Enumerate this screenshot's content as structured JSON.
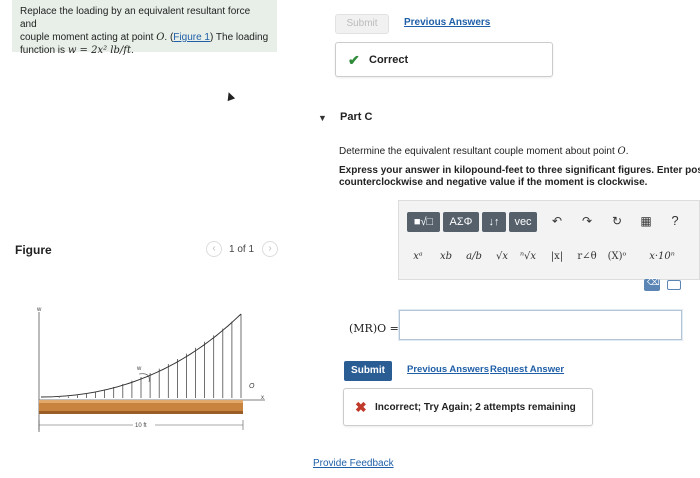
{
  "problem": {
    "line1": "Replace the loading by an equivalent resultant force and",
    "line2_pre": "couple moment acting at point ",
    "point": "O",
    "line2_mid": ". (",
    "figure_link": "Figure 1",
    "line2_post": ") The loading",
    "line3_pre": "function is ",
    "formula": "w = 2x² lb/ft",
    "line3_post": "."
  },
  "top": {
    "submit_label": "Submit",
    "previous_answers": "Previous Answers",
    "correct_text": "Correct"
  },
  "part": {
    "title": "Part C",
    "question_pre": "Determine the equivalent resultant couple moment about point ",
    "question_point": "O",
    "question_post": ".",
    "instruction_line1": "Express your answer in kilopound-feet to three significant figures. Enter positi",
    "instruction_line2": "counterclockwise and negative value if the moment is clockwise."
  },
  "figure": {
    "label": "Figure",
    "pager": "1 of 1",
    "prev_icon": "‹",
    "next_icon": "›",
    "w_label": "w",
    "w_label2": "w",
    "o_label": "O",
    "x_label": "x",
    "dim_label": "10 ft"
  },
  "editor": {
    "btn_templates": "■√□",
    "btn_greek": "ΑΣΦ",
    "btn_arrows": "↓↑",
    "btn_vec": "vec",
    "undo_icon": "↶",
    "redo_icon": "↷",
    "reset_icon": "↻",
    "keyboard_icon": "▦",
    "help_icon": "?",
    "sym_power": "xᵃ",
    "sym_sub": "xb",
    "sym_frac": "a/b",
    "sym_sqrt": "√x",
    "sym_nroot": "ⁿ√x",
    "sym_abs": "|x|",
    "sym_polar": "r∠θ",
    "sym_vector": "(X)ᵒ",
    "sym_sci": "x·10ⁿ",
    "delete_icon": "⌫"
  },
  "answer": {
    "label": "(MR)O =",
    "value": "",
    "submit_label": "Submit",
    "previous_answers": "Previous Answers",
    "request_answer": "Request Answer",
    "incorrect_text": "Incorrect; Try Again; 2 attempts remaining"
  },
  "footer": {
    "feedback": "Provide Feedback"
  },
  "colors": {
    "accent": "#2a5d94",
    "link": "#1f5fa8",
    "correct": "#2e8b3a",
    "incorrect": "#c0392b",
    "beam": "#c8833f"
  }
}
